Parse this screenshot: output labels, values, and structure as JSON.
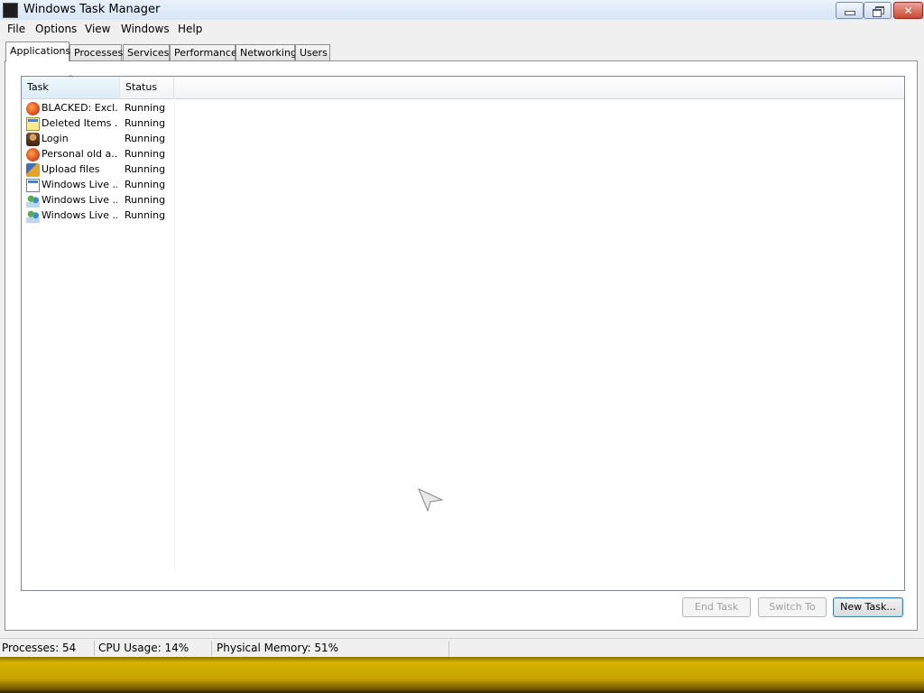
{
  "window": {
    "title": "Windows Task Manager"
  },
  "menu": [
    "File",
    "Options",
    "View",
    "Windows",
    "Help"
  ],
  "tabs": [
    "Applications",
    "Processes",
    "Services",
    "Performance",
    "Networking",
    "Users"
  ],
  "active_tab": "Applications",
  "list": {
    "columns": [
      "Task",
      "Status"
    ],
    "sorted_by": "Task",
    "rows": [
      {
        "task": "BLACKED: Excl...",
        "status": "Running",
        "icon": "firefox-icon"
      },
      {
        "task": "Deleted Items ...",
        "status": "Running",
        "icon": "window-icon"
      },
      {
        "task": "Login",
        "status": "Running",
        "icon": "login-icon"
      },
      {
        "task": "Personal old a...",
        "status": "Running",
        "icon": "firefox-icon"
      },
      {
        "task": "Upload files",
        "status": "Running",
        "icon": "upload-icon"
      },
      {
        "task": "Windows Live ...",
        "status": "Running",
        "icon": "window-icon"
      },
      {
        "task": "Windows Live ...",
        "status": "Running",
        "icon": "messenger-icon"
      },
      {
        "task": "Windows Live ...",
        "status": "Running",
        "icon": "messenger-icon"
      }
    ]
  },
  "buttons": {
    "end_task": "End Task",
    "switch_to": "Switch To",
    "new_task": "New Task..."
  },
  "statusbar": {
    "processes": "Processes: 54",
    "cpu": "CPU Usage: 14%",
    "memory": "Physical Memory: 51%"
  },
  "colors": {
    "titlebar": "#dbe8f6",
    "close_button": "#c94a32",
    "taskbar": "#c9a400"
  }
}
